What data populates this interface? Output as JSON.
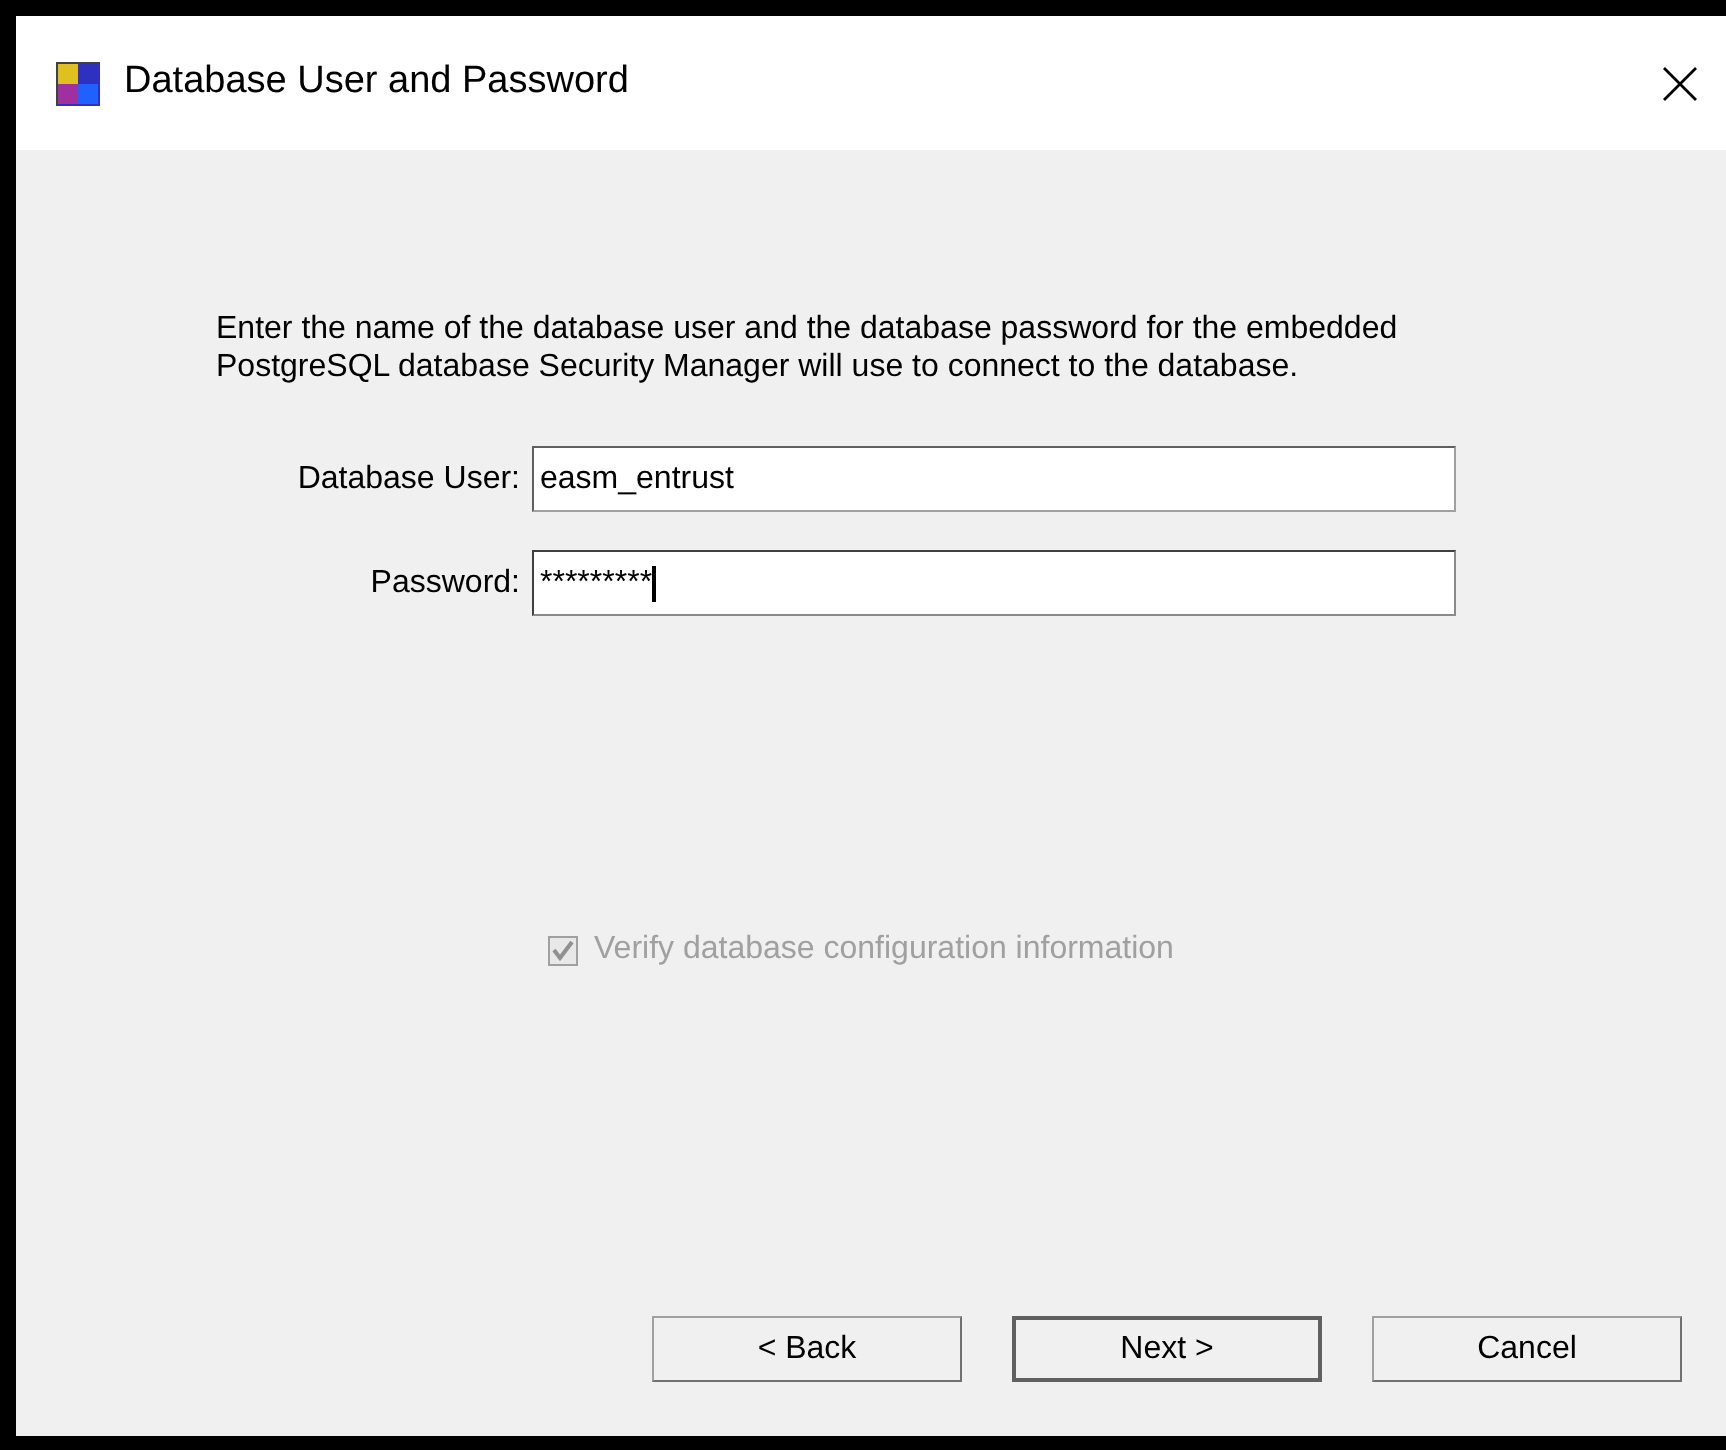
{
  "window": {
    "title": "Database User and Password"
  },
  "description": "Enter the name of the database user and the database password for the embedded PostgreSQL database Security Manager will use to connect to the database.",
  "fields": [
    {
      "label": "Database User:",
      "value": "easm_entrust",
      "focused": false
    },
    {
      "label": "Password:",
      "value": "*********",
      "focused": true
    }
  ],
  "checkbox": {
    "label": "Verify database configuration information",
    "checked": true,
    "disabled": true
  },
  "buttons": [
    {
      "label": "< Back",
      "default": false
    },
    {
      "label": "Next >",
      "default": true
    },
    {
      "label": "Cancel",
      "default": false
    }
  ]
}
